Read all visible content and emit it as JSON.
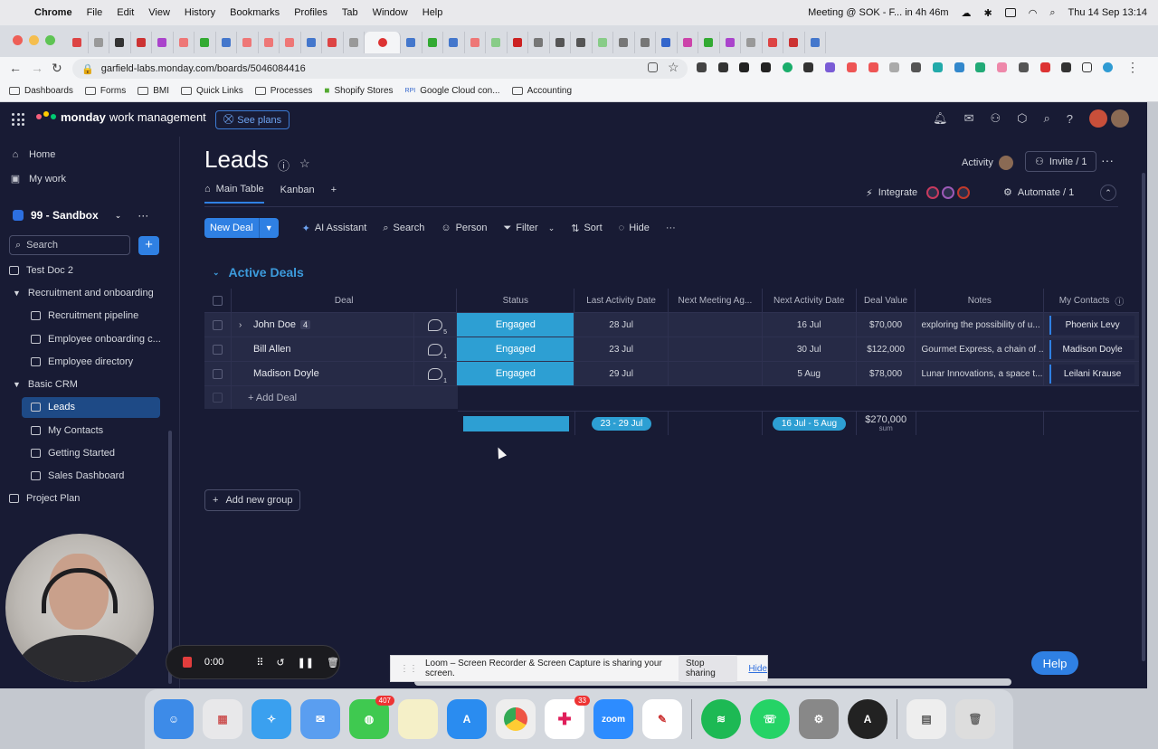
{
  "menubar": {
    "app": "Chrome",
    "menus": [
      "File",
      "Edit",
      "View",
      "History",
      "Bookmarks",
      "Profiles",
      "Tab",
      "Window",
      "Help"
    ],
    "meeting": "Meeting @ SOK - F... in 4h 46m",
    "datetime": "Thu 14 Sep  13:14"
  },
  "browser": {
    "url": "garfield-labs.monday.com/boards/5046084416",
    "bookmarks": [
      "Dashboards",
      "Forms",
      "BMI",
      "Quick Links",
      "Processes",
      "Shopify Stores",
      "Google Cloud con...",
      "Accounting"
    ]
  },
  "app": {
    "brand_bold": "monday",
    "brand_rest": "work management",
    "see_plans": "See plans"
  },
  "sidebar": {
    "home": "Home",
    "my_work": "My work",
    "workspace": "99 - Sandbox",
    "search_placeholder": "Search",
    "items": [
      {
        "label": "Test Doc 2"
      },
      {
        "label": "Recruitment and onboarding"
      },
      {
        "label": "Recruitment pipeline"
      },
      {
        "label": "Employee onboarding c..."
      },
      {
        "label": "Employee directory"
      },
      {
        "label": "Basic CRM"
      },
      {
        "label": "Leads"
      },
      {
        "label": "My Contacts"
      },
      {
        "label": "Getting Started"
      },
      {
        "label": "Sales Dashboard"
      },
      {
        "label": "Project Plan"
      }
    ]
  },
  "board": {
    "title": "Leads",
    "activity": "Activity",
    "invite": "Invite / 1",
    "tabs": [
      "Main Table",
      "Kanban"
    ],
    "integrate": "Integrate",
    "automate": "Automate / 1",
    "toolbar": {
      "new_item": "New Deal",
      "ai": "AI Assistant",
      "search": "Search",
      "person": "Person",
      "filter": "Filter",
      "sort": "Sort",
      "hide": "Hide"
    },
    "group_title": "Active Deals",
    "columns": [
      "Deal",
      "Status",
      "Last Activity Date",
      "Next Meeting Ag...",
      "Next Activity Date",
      "Deal Value",
      "Notes",
      "My Contacts"
    ],
    "rows": [
      {
        "deal": "John Doe",
        "subitems": "4",
        "updates": "5",
        "status": "Engaged",
        "last": "28 Jul",
        "next_meeting": "",
        "next_act": "16 Jul",
        "value": "$70,000",
        "notes": "exploring the possibility of u...",
        "contact": "Phoenix Levy"
      },
      {
        "deal": "Bill Allen",
        "subitems": "",
        "updates": "1",
        "status": "Engaged",
        "last": "23 Jul",
        "next_meeting": "",
        "next_act": "30 Jul",
        "value": "$122,000",
        "notes": "Gourmet Express, a chain of ...",
        "contact": "Madison Doyle"
      },
      {
        "deal": "Madison Doyle",
        "subitems": "",
        "updates": "1",
        "status": "Engaged",
        "last": "29 Jul",
        "next_meeting": "",
        "next_act": "5 Aug",
        "value": "$78,000",
        "notes": "Lunar Innovations, a space t...",
        "contact": "Leilani Krause"
      }
    ],
    "add_item": "+ Add Deal",
    "summary": {
      "last_range": "23 - 29 Jul",
      "next_range": "16 Jul - 5 Aug",
      "value_total": "$270,000",
      "value_func": "sum"
    },
    "add_group": "Add new group",
    "help": "Help"
  },
  "loom": {
    "timer": "0:00",
    "sharing_text": "Loom – Screen Recorder & Screen Capture is sharing your screen.",
    "stop": "Stop sharing",
    "hide": "Hide"
  },
  "dock": {
    "messages_badge": "407",
    "slack_badge": "33",
    "zoom_label": "zoom"
  },
  "colors": {
    "app_bg": "#181b34",
    "accent": "#2f80e3",
    "status_engaged": "#2d9fd3",
    "group_color": "#3c9bdc"
  }
}
